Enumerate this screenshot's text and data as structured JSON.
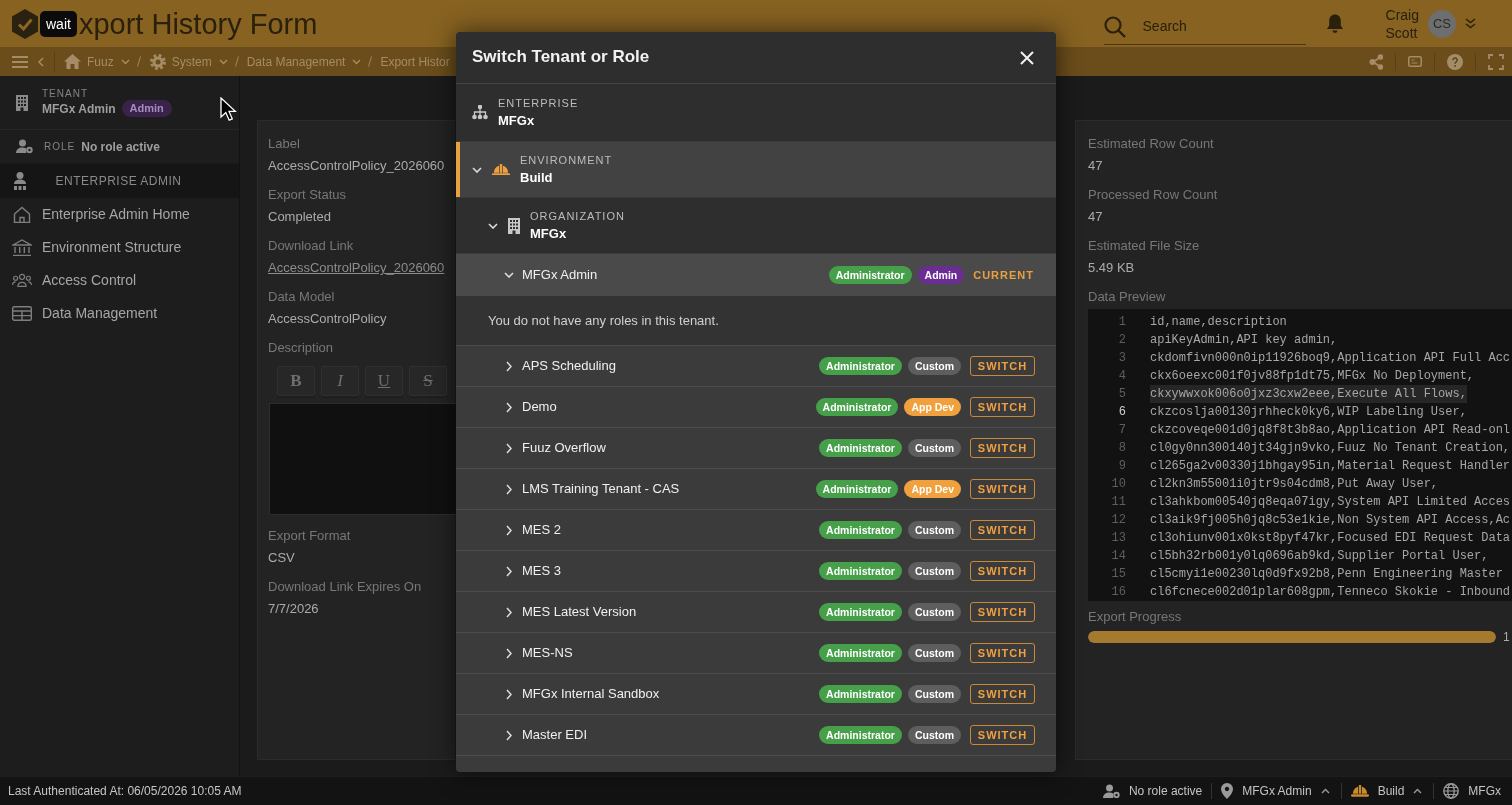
{
  "header": {
    "tooltip": "wait",
    "title": "xport History Form",
    "search": {
      "placeholder": "Search"
    },
    "user": {
      "name": "Craig Scott",
      "initials": "CS"
    }
  },
  "breadcrumbs": [
    {
      "label": "Fuuz"
    },
    {
      "label": "System"
    },
    {
      "label": "Data Management"
    }
  ],
  "current_page": "Export Histor",
  "sidebar": {
    "tenant": {
      "label": "TENANT",
      "name": "MFGx Admin",
      "badge": "Admin"
    },
    "role": {
      "label": "ROLE",
      "value": "No role active"
    },
    "section": "ENTERPRISE ADMIN",
    "items": [
      {
        "label": "Enterprise Admin Home"
      },
      {
        "label": "Environment Structure"
      },
      {
        "label": "Access Control"
      },
      {
        "label": "Data Management"
      }
    ]
  },
  "left_panel": {
    "fields": [
      {
        "kind": "text",
        "label": "Label",
        "value": "AccessControlPolicy_2026060"
      },
      {
        "kind": "text",
        "label": "Export Status",
        "value": "Completed"
      },
      {
        "kind": "link",
        "label": "Download Link",
        "value": "AccessControlPolicy_2026060"
      },
      {
        "kind": "text",
        "label": "Data Model",
        "value": "AccessControlPolicy"
      },
      {
        "kind": "editor",
        "label": "Description",
        "toolbar": [
          "B",
          "I",
          "U",
          "S"
        ]
      },
      {
        "kind": "text",
        "label": "Export Format",
        "value": "CSV"
      },
      {
        "kind": "text",
        "label": "Download Link Expires On",
        "value": "7/7/2026"
      }
    ]
  },
  "right_panel": {
    "fields": [
      {
        "label": "Estimated Row Count",
        "value": "47"
      },
      {
        "label": "Processed Row Count",
        "value": "47"
      },
      {
        "label": "Estimated File Size",
        "value": "5.49 KB"
      }
    ],
    "data_preview": {
      "label": "Data Preview",
      "lines": [
        {
          "number": "1",
          "text": "id,name,description",
          "highlighted": false,
          "active": false
        },
        {
          "number": "2",
          "text": "apiKeyAdmin,API key admin,",
          "highlighted": false,
          "active": false
        },
        {
          "number": "3",
          "text": "ckdomfivn000n0ip11926boq9,Application API Full Acc",
          "highlighted": false,
          "active": false
        },
        {
          "number": "4",
          "text": "ckx6oeexc001f0jv88fp1dt75,MFGx No Deployment,",
          "highlighted": false,
          "active": false
        },
        {
          "number": "5",
          "text": "ckxywwxok006o0jxz3cxw2eee,Execute All Flows,",
          "highlighted": true,
          "active": false
        },
        {
          "number": "6",
          "text": "ckzcoslja00130jrhheck0ky6,WIP Labeling User,",
          "highlighted": false,
          "active": true
        },
        {
          "number": "7",
          "text": "ckzcoveqe001d0jq8f8t3b8ao,Application API Read-onl",
          "highlighted": false,
          "active": false
        },
        {
          "number": "8",
          "text": "cl0gy0nn300140jt34gjn9vko,Fuuz No Tenant Creation,",
          "highlighted": false,
          "active": false
        },
        {
          "number": "9",
          "text": "cl265ga2v00330j1bhgay95in,Material Request Handler",
          "highlighted": false,
          "active": false
        },
        {
          "number": "10",
          "text": "cl2kn3m55001i0jtr9s04cdm8,Put Away User,",
          "highlighted": false,
          "active": false
        },
        {
          "number": "11",
          "text": "cl3ahkbom00540jq8eqa07igy,System API Limited Acces",
          "highlighted": false,
          "active": false
        },
        {
          "number": "12",
          "text": "cl3aik9fj005h0jq8c53e1kie,Non System API Access,Ac",
          "highlighted": false,
          "active": false
        },
        {
          "number": "13",
          "text": "cl3ohiunv001x0kst8pyf47kr,Focused EDI Request Data",
          "highlighted": false,
          "active": false
        },
        {
          "number": "14",
          "text": "cl5bh32rb001y0lq0696ab9kd,Supplier Portal User,",
          "highlighted": false,
          "active": false
        },
        {
          "number": "15",
          "text": "cl5cmyi1e00230lq0d9fx92b8,Penn Engineering Master",
          "highlighted": false,
          "active": false
        },
        {
          "number": "16",
          "text": "cl6fcnece002d01plar608gpm,Tenneco Skokie - Inbound",
          "highlighted": false,
          "active": false
        }
      ]
    },
    "progress": {
      "label": "Export Progress",
      "level": 1,
      "reading": "1"
    }
  },
  "modal": {
    "title": "Switch Tenant or Role",
    "tree": {
      "kind": "enterprise",
      "label": "ENTERPRISE",
      "name": "MFGx",
      "selected": false,
      "children": [
        {
          "kind": "environment",
          "label": "ENVIRONMENT",
          "name": "Build",
          "expanded": true,
          "selected": true,
          "children": [
            {
              "kind": "organization",
              "label": "ORGANIZATION",
              "name": "MFGx",
              "expanded": true,
              "selected": false,
              "children": [
                {
                  "kind": "tenant",
                  "name": "MFGx Admin",
                  "expanded": true,
                  "current": true,
                  "badges": [
                    {
                      "text": "Administrator",
                      "color": "#45a049"
                    },
                    {
                      "text": "Admin",
                      "color": "#6b2d94"
                    }
                  ],
                  "action": "CURRENT",
                  "message": "You do not have any roles in this tenant."
                },
                {
                  "kind": "tenant",
                  "name": "APS Scheduling",
                  "expanded": false,
                  "current": false,
                  "badges": [
                    {
                      "text": "Administrator",
                      "color": "#45a049"
                    },
                    {
                      "text": "Custom",
                      "color": "#5e5e5e"
                    }
                  ],
                  "action": "SWITCH"
                },
                {
                  "kind": "tenant",
                  "name": "Demo",
                  "expanded": false,
                  "current": false,
                  "badges": [
                    {
                      "text": "Administrator",
                      "color": "#45a049"
                    },
                    {
                      "text": "App Dev",
                      "color": "#f0a03c"
                    }
                  ],
                  "action": "SWITCH"
                },
                {
                  "kind": "tenant",
                  "name": "Fuuz Overflow",
                  "expanded": false,
                  "current": false,
                  "badges": [
                    {
                      "text": "Administrator",
                      "color": "#45a049"
                    },
                    {
                      "text": "Custom",
                      "color": "#5e5e5e"
                    }
                  ],
                  "action": "SWITCH"
                },
                {
                  "kind": "tenant",
                  "name": "LMS Training Tenant - CAS",
                  "expanded": false,
                  "current": false,
                  "badges": [
                    {
                      "text": "Administrator",
                      "color": "#45a049"
                    },
                    {
                      "text": "App Dev",
                      "color": "#f0a03c"
                    }
                  ],
                  "action": "SWITCH"
                },
                {
                  "kind": "tenant",
                  "name": "MES 2",
                  "expanded": false,
                  "current": false,
                  "badges": [
                    {
                      "text": "Administrator",
                      "color": "#45a049"
                    },
                    {
                      "text": "Custom",
                      "color": "#5e5e5e"
                    }
                  ],
                  "action": "SWITCH"
                },
                {
                  "kind": "tenant",
                  "name": "MES 3",
                  "expanded": false,
                  "current": false,
                  "badges": [
                    {
                      "text": "Administrator",
                      "color": "#45a049"
                    },
                    {
                      "text": "Custom",
                      "color": "#5e5e5e"
                    }
                  ],
                  "action": "SWITCH"
                },
                {
                  "kind": "tenant",
                  "name": "MES Latest Version",
                  "expanded": false,
                  "current": false,
                  "badges": [
                    {
                      "text": "Administrator",
                      "color": "#45a049"
                    },
                    {
                      "text": "Custom",
                      "color": "#5e5e5e"
                    }
                  ],
                  "action": "SWITCH"
                },
                {
                  "kind": "tenant",
                  "name": "MES-NS",
                  "expanded": false,
                  "current": false,
                  "badges": [
                    {
                      "text": "Administrator",
                      "color": "#45a049"
                    },
                    {
                      "text": "Custom",
                      "color": "#5e5e5e"
                    }
                  ],
                  "action": "SWITCH"
                },
                {
                  "kind": "tenant",
                  "name": "MFGx Internal Sandbox",
                  "expanded": false,
                  "current": false,
                  "badges": [
                    {
                      "text": "Administrator",
                      "color": "#45a049"
                    },
                    {
                      "text": "Custom",
                      "color": "#5e5e5e"
                    }
                  ],
                  "action": "SWITCH"
                },
                {
                  "kind": "tenant",
                  "name": "Master EDI",
                  "expanded": false,
                  "current": false,
                  "badges": [
                    {
                      "text": "Administrator",
                      "color": "#45a049"
                    },
                    {
                      "text": "Custom",
                      "color": "#5e5e5e"
                    }
                  ],
                  "action": "SWITCH"
                }
              ]
            }
          ]
        }
      ]
    }
  },
  "status_bar": {
    "text": "Last Authenticated At: 06/05/2026 10:05 AM",
    "items": [
      {
        "text": "No role active",
        "menu": false
      },
      {
        "text": "MFGx Admin",
        "menu": true
      },
      {
        "text": "Build",
        "menu": true
      },
      {
        "text": "MFGx",
        "menu": false
      }
    ]
  }
}
